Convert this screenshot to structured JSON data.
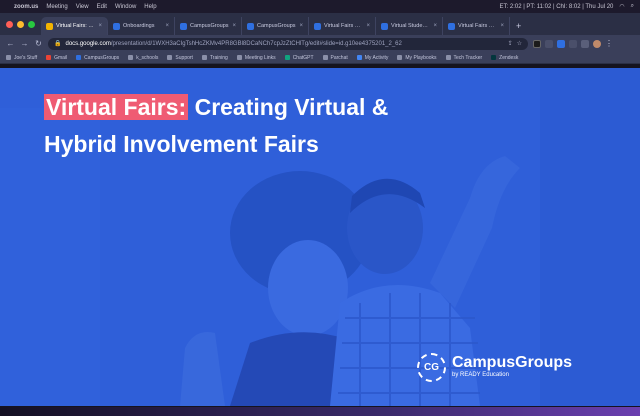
{
  "menubar": {
    "app": "zoom.us",
    "items": [
      "Meeting",
      "View",
      "Edit",
      "Window",
      "Help"
    ],
    "clock": "ET: 2:02 | PT: 11:02 | ChI: 8:02 | Thu Jul 20"
  },
  "tabs": [
    {
      "title": "Virtual Fairs: Creati",
      "color": "#f4b400",
      "active": true
    },
    {
      "title": "Onboardings",
      "color": "#2f6fe0",
      "active": false
    },
    {
      "title": "CampusGroups",
      "color": "#2f6fe0",
      "active": false
    },
    {
      "title": "CampusGroups",
      "color": "#2f6fe0",
      "active": false
    },
    {
      "title": "Virtual Fairs Map V",
      "color": "#2f6fe0",
      "active": false
    },
    {
      "title": "Virtual Student Inv",
      "color": "#2f6fe0",
      "active": false
    },
    {
      "title": "Virtual Fairs Map V",
      "color": "#2f6fe0",
      "active": false
    }
  ],
  "address": {
    "host": "docs.google.com",
    "path": "/presentation/d/1WXH3aCIgTshHcZKMv4PR8GBl8DCaNCh7cpJzZtCHlTg/edit#slide=id.g10ee4375201_2_62"
  },
  "bookmarks": [
    {
      "label": "Joe's Stuff",
      "color": "#8a8fa8"
    },
    {
      "label": "Gmail",
      "color": "#ea4335"
    },
    {
      "label": "CampusGroups",
      "color": "#2f6fe0"
    },
    {
      "label": "k_schools",
      "color": "#8a8fa8"
    },
    {
      "label": "Support",
      "color": "#8a8fa8"
    },
    {
      "label": "Training",
      "color": "#8a8fa8"
    },
    {
      "label": "Meeting Links",
      "color": "#8a8fa8"
    },
    {
      "label": "ChatGPT",
      "color": "#10a37f"
    },
    {
      "label": "Parchat",
      "color": "#8a8fa8"
    },
    {
      "label": "My Activity",
      "color": "#4285f4"
    },
    {
      "label": "My Playbooks",
      "color": "#8a8fa8"
    },
    {
      "label": "Tech Tracker",
      "color": "#8a8fa8"
    },
    {
      "label": "Zendesk",
      "color": "#03363d"
    }
  ],
  "slide": {
    "title_highlight": "Virtual Fairs:",
    "title_rest": " Creating Virtual &",
    "title_line2": "Hybrid Involvement Fairs",
    "logo_mark": "CG",
    "logo_name": "CampusGroups",
    "logo_by": "by READY Education",
    "background": "#2f5fd9",
    "highlight_color": "#ef5b73"
  }
}
